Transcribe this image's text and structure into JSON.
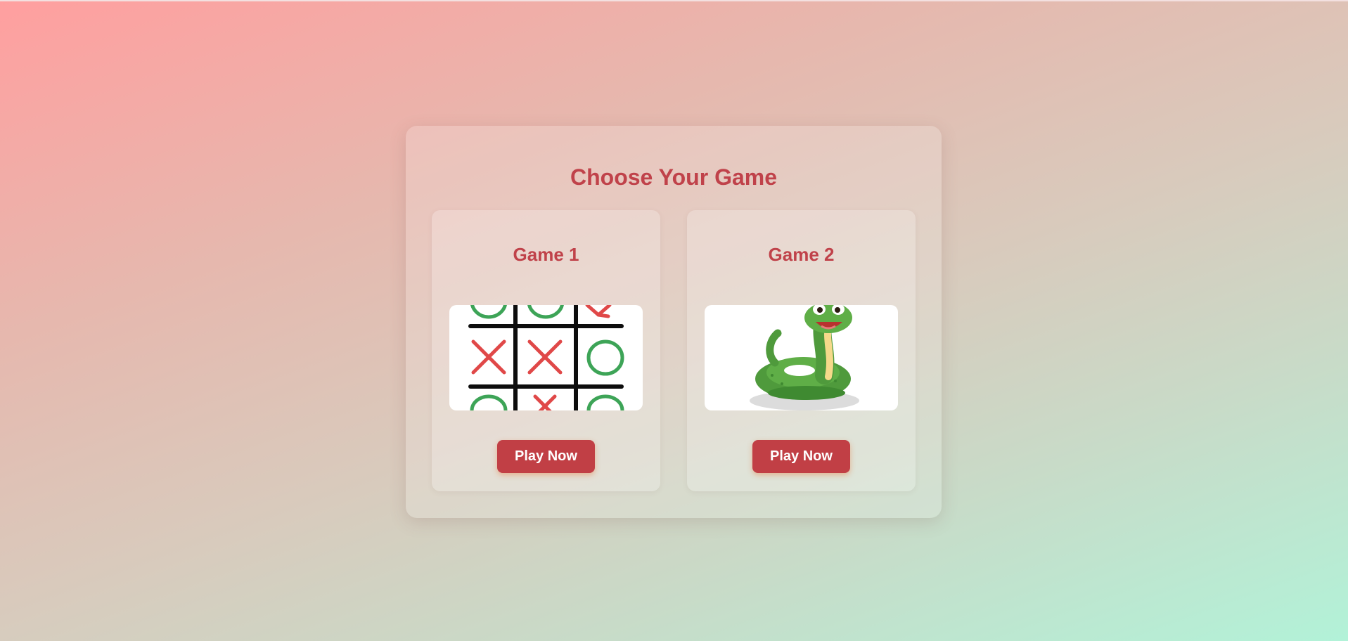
{
  "page": {
    "title": "Choose Your Game"
  },
  "games": [
    {
      "title": "Game 1",
      "image_icon": "tic-tac-toe-board-image",
      "button_label": "Play Now"
    },
    {
      "title": "Game 2",
      "image_icon": "cartoon-snake-image",
      "button_label": "Play Now"
    }
  ],
  "colors": {
    "accent": "#c0424a",
    "button_bg": "#c13f45",
    "button_text": "#ffffff",
    "x_mark": "#e04848",
    "o_mark": "#3da457",
    "snake_green": "#4f9a3c"
  }
}
